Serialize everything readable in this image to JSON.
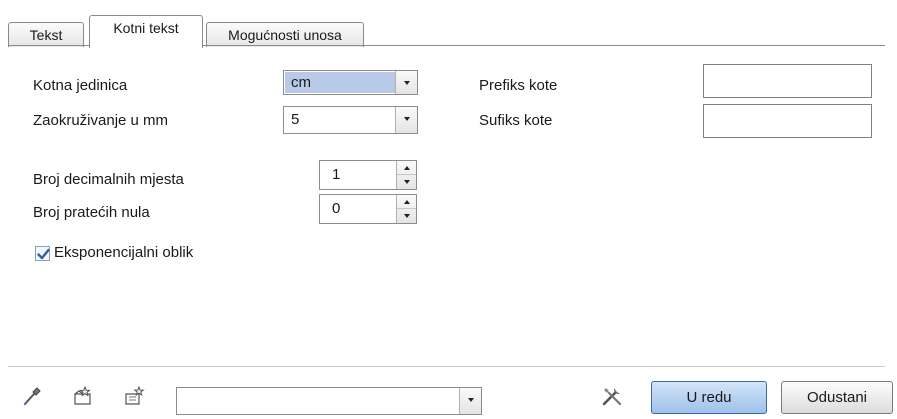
{
  "tabs": [
    {
      "label": "Tekst",
      "active": false
    },
    {
      "label": "Kotni tekst",
      "active": true
    },
    {
      "label": "Mogućnosti unosa",
      "active": false
    }
  ],
  "form": {
    "unit_label": "Kotna jedinica",
    "unit_value": "cm",
    "rounding_label": "Zaokruživanje u mm",
    "rounding_value": "5",
    "decimals_label": "Broj decimalnih mjesta",
    "decimals_value": "1",
    "trailing_zeros_label": "Broj pratećih nula",
    "trailing_zeros_value": "0",
    "exponential_label": "Eksponencijalni oblik",
    "exponential_checked": true,
    "prefix_label": "Prefiks kote",
    "prefix_value": "",
    "suffix_label": "Sufiks kote",
    "suffix_value": ""
  },
  "footer": {
    "icons": [
      "eyedropper-icon",
      "open-favorites-icon",
      "save-favorites-icon",
      "tools-icon"
    ],
    "favorites_value": "",
    "ok_label": "U redu",
    "cancel_label": "Odustani"
  },
  "colors": {
    "selection": "#b9c9e8",
    "primary_button": "#9ec1ea",
    "checkmark": "#2e5fa8"
  }
}
